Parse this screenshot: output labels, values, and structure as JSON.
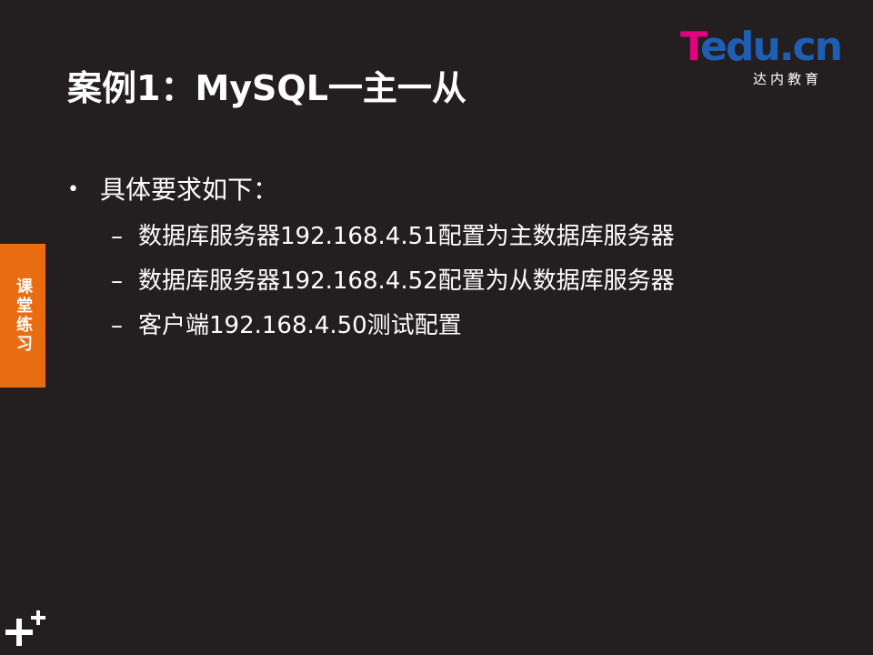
{
  "logo": {
    "wordmark_t": "T",
    "wordmark_rest": "edu.cn",
    "subtitle": "达内教育"
  },
  "slide": {
    "title": "案例1：MySQL一主一从",
    "bullet": {
      "marker": "•",
      "text": "具体要求如下："
    },
    "sub_marker": "–",
    "sub_items": [
      "数据库服务器192.168.4.51配置为主数据库服务器",
      "数据库服务器192.168.4.52配置为从数据库服务器",
      "客户端192.168.4.50测试配置"
    ]
  },
  "side_tab": {
    "label": "课堂练习"
  },
  "icons": {
    "corner": "plus-icon"
  },
  "colors": {
    "background": "#231f20",
    "side_tab": "#ea6c10",
    "logo_pink": "#e4007f",
    "logo_blue": "#1e5fb4"
  }
}
